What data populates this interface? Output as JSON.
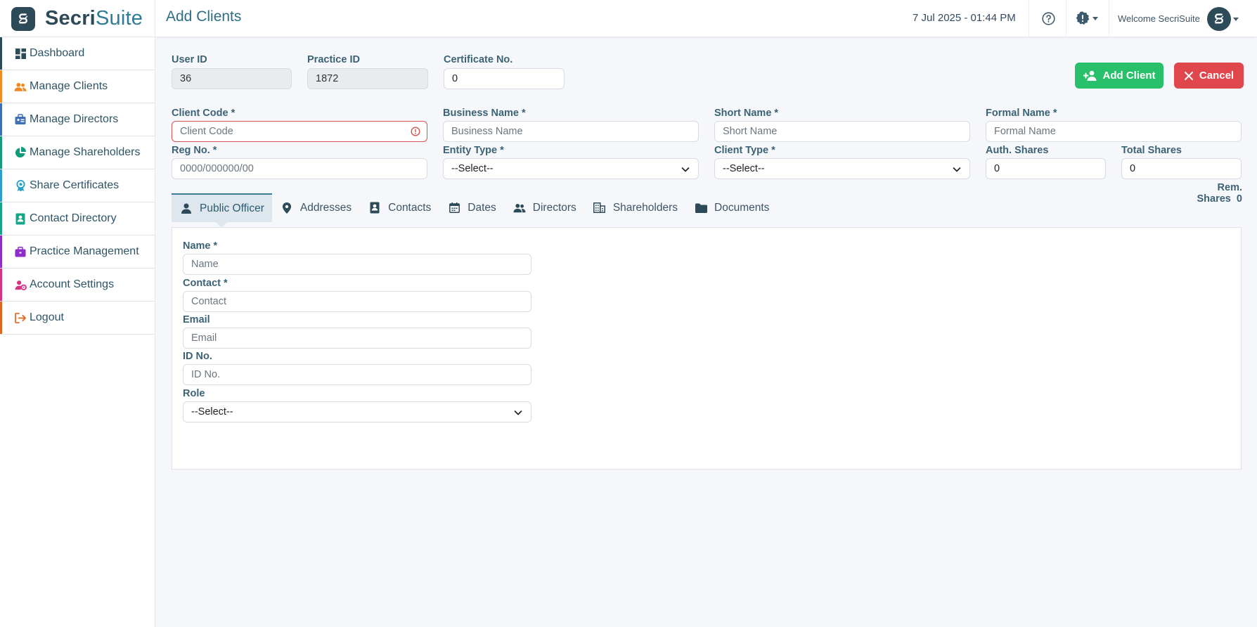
{
  "brand": {
    "name_main": "Secri",
    "name_accent": "Suite"
  },
  "header": {
    "title": "Add Clients",
    "datetime": "7 Jul 2025 - 01:44 PM",
    "welcome": "Welcome SecriSuite"
  },
  "sidebar": {
    "items": [
      {
        "label": "Dashboard",
        "icon": "dashboard-icon",
        "color": "#2c4a57"
      },
      {
        "label": "Manage Clients",
        "icon": "users-icon",
        "color": "#f08a24"
      },
      {
        "label": "Manage Directors",
        "icon": "director-icon",
        "color": "#3f6fb5"
      },
      {
        "label": "Manage Shareholders",
        "icon": "pie-chart-icon",
        "color": "#119b7a"
      },
      {
        "label": "Share Certificates",
        "icon": "certificate-icon",
        "color": "#2aa0c8"
      },
      {
        "label": "Contact Directory",
        "icon": "contact-book-icon",
        "color": "#17a589"
      },
      {
        "label": "Practice Management",
        "icon": "briefcase-icon",
        "color": "#8e2dc9"
      },
      {
        "label": "Account Settings",
        "icon": "user-settings-icon",
        "color": "#d63384"
      },
      {
        "label": "Logout",
        "icon": "logout-icon",
        "color": "#e0651e"
      }
    ]
  },
  "form": {
    "user_id": {
      "label": "User ID",
      "value": "36"
    },
    "practice_id": {
      "label": "Practice ID",
      "value": "1872"
    },
    "certificate_no": {
      "label": "Certificate No.",
      "value": "0"
    },
    "client_code": {
      "label": "Client Code *",
      "placeholder": "Client Code"
    },
    "business_name": {
      "label": "Business Name *",
      "placeholder": "Business Name"
    },
    "short_name": {
      "label": "Short Name *",
      "placeholder": "Short Name"
    },
    "formal_name": {
      "label": "Formal Name *",
      "placeholder": "Formal Name"
    },
    "reg_no": {
      "label": "Reg No. *",
      "placeholder": "0000/000000/00"
    },
    "entity_type": {
      "label": "Entity Type *",
      "selected": "--Select--"
    },
    "client_type": {
      "label": "Client Type *",
      "selected": "--Select--"
    },
    "auth_shares": {
      "label": "Auth. Shares",
      "value": "0"
    },
    "total_shares": {
      "label": "Total Shares",
      "value": "0"
    },
    "rem_shares": {
      "label": "Rem. Shares",
      "value": "0"
    }
  },
  "buttons": {
    "add_client": "Add Client",
    "cancel": "Cancel"
  },
  "tabs": [
    {
      "label": "Public Officer",
      "icon": "person-icon",
      "active": true
    },
    {
      "label": "Addresses",
      "icon": "map-pin-icon"
    },
    {
      "label": "Contacts",
      "icon": "contact-card-icon"
    },
    {
      "label": "Dates",
      "icon": "calendar-icon"
    },
    {
      "label": "Directors",
      "icon": "people-icon"
    },
    {
      "label": "Shareholders",
      "icon": "building-icon"
    },
    {
      "label": "Documents",
      "icon": "folder-icon"
    }
  ],
  "public_officer": {
    "name": {
      "label": "Name *",
      "placeholder": "Name"
    },
    "contact": {
      "label": "Contact *",
      "placeholder": "Contact"
    },
    "email": {
      "label": "Email",
      "placeholder": "Email"
    },
    "id_no": {
      "label": "ID No.",
      "placeholder": "ID No."
    },
    "role": {
      "label": "Role",
      "selected": "--Select--"
    }
  },
  "colors": {
    "brand": "#2c4a57",
    "accent": "#2e7c94",
    "add_button": "#28c06a",
    "cancel_button": "#e0474c",
    "invalid": "#d9534f"
  }
}
